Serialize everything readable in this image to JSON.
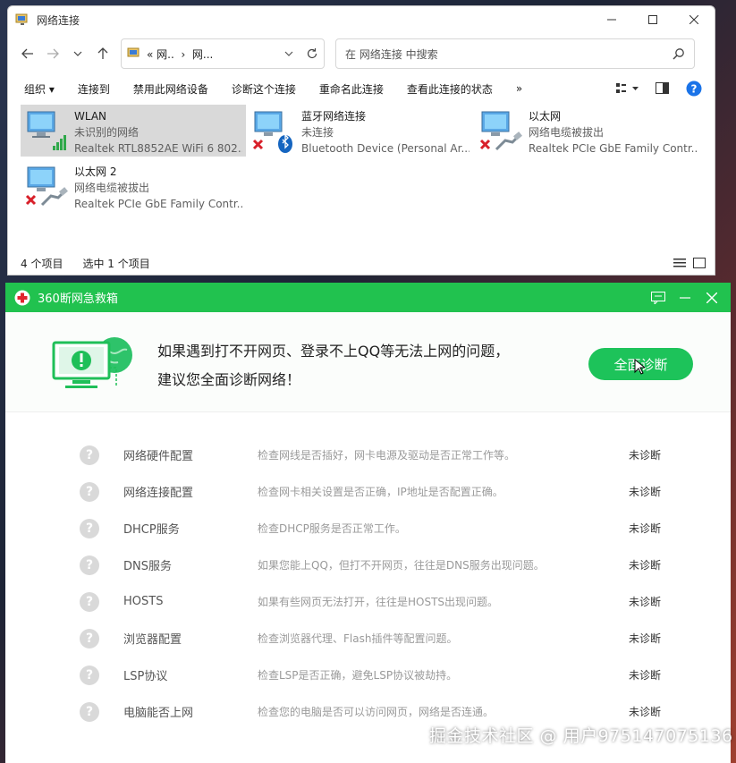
{
  "explorer": {
    "title": "网络连接",
    "address": {
      "crumb1": "« 网..",
      "sep": "›",
      "crumb2": "网..."
    },
    "search_placeholder": "在 网络连接 中搜索",
    "commands": [
      "组织 ▾",
      "连接到",
      "禁用此网络设备",
      "诊断这个连接",
      "重命名此连接",
      "查看此连接的状态",
      "»"
    ],
    "items": [
      {
        "name": "WLAN",
        "status": "未识别的网络",
        "device": "Realtek RTL8852AE WiFi 6 802....",
        "selected": true,
        "type": "wifi"
      },
      {
        "name": "蓝牙网络连接",
        "status": "未连接",
        "device": "Bluetooth Device (Personal Ar...",
        "selected": false,
        "type": "bluetooth"
      },
      {
        "name": "以太网",
        "status": "网络电缆被拔出",
        "device": "Realtek PCIe GbE Family Contr...",
        "selected": false,
        "type": "ethernet"
      },
      {
        "name": "以太网 2",
        "status": "网络电缆被拔出",
        "device": "Realtek PCIe GbE Family Contr...",
        "selected": false,
        "type": "ethernet"
      }
    ],
    "status": {
      "count": "4 个项目",
      "selected": "选中 1 个项目"
    }
  },
  "rescue": {
    "title": "360断网急救箱",
    "message_line1": "如果遇到打不开网页、登录不上QQ等无法上网的问题，",
    "message_line2": "建议您全面诊断网络！",
    "diagnose_button": "全面诊断",
    "rows": [
      {
        "name": "网络硬件配置",
        "desc": "检查网线是否插好，网卡电源及驱动是否正常工作等。",
        "status": "未诊断"
      },
      {
        "name": "网络连接配置",
        "desc": "检查网卡相关设置是否正确，IP地址是否配置正确。",
        "status": "未诊断"
      },
      {
        "name": "DHCP服务",
        "desc": "检查DHCP服务是否正常工作。",
        "status": "未诊断"
      },
      {
        "name": "DNS服务",
        "desc": "如果您能上QQ，但打不开网页，往往是DNS服务出现问题。",
        "status": "未诊断"
      },
      {
        "name": "HOSTS",
        "desc": "如果有些网页无法打开，往往是HOSTS出现问题。",
        "status": "未诊断"
      },
      {
        "name": "浏览器配置",
        "desc": "检查浏览器代理、Flash插件等配置问题。",
        "status": "未诊断"
      },
      {
        "name": "LSP协议",
        "desc": "检查LSP是否正确，避免LSP协议被劫持。",
        "status": "未诊断"
      },
      {
        "name": "电脑能否上网",
        "desc": "检查您的电脑是否可以访问网页，网络是否连通。",
        "status": "未诊断"
      }
    ],
    "question_mark": "?"
  },
  "watermark": "掘金技术社区 @ 用户975147075136",
  "colors": {
    "accent_green": "#21c24f",
    "button_green": "#1dc35a",
    "error_red": "#d8202a"
  }
}
